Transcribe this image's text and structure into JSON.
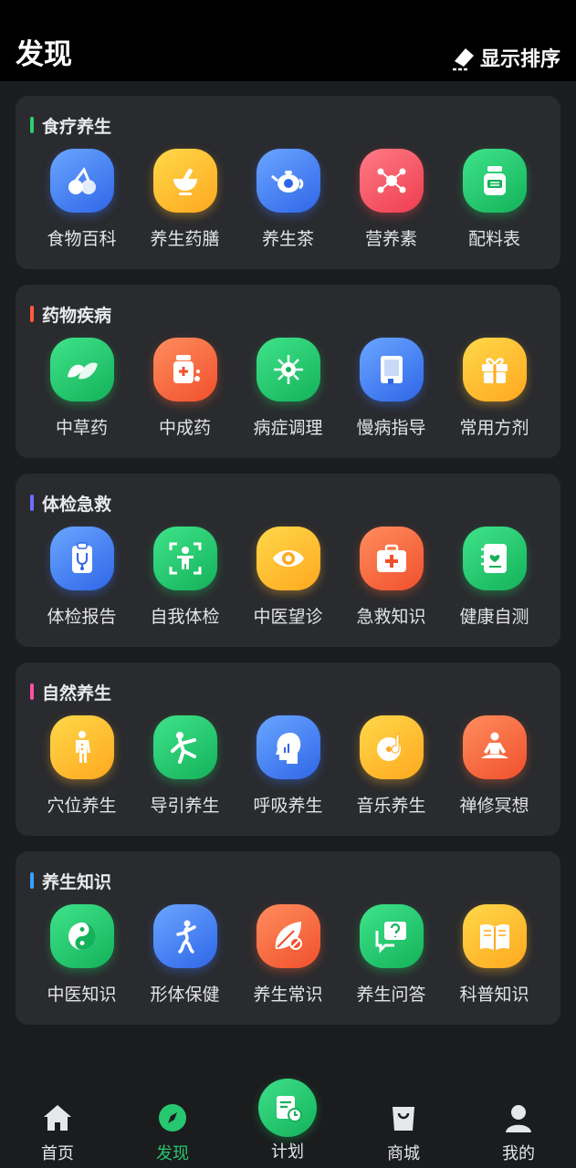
{
  "header": {
    "title": "发现",
    "sort_label": "显示排序"
  },
  "sections": [
    {
      "title": "食疗养生",
      "accent": "#2ecc71",
      "items": [
        {
          "label": "食物百科",
          "icon": "cherry-icon",
          "color": "blue"
        },
        {
          "label": "养生药膳",
          "icon": "mortar-pestle-icon",
          "color": "yellow"
        },
        {
          "label": "养生茶",
          "icon": "teapot-icon",
          "color": "blue"
        },
        {
          "label": "营养素",
          "icon": "molecule-icon",
          "color": "red"
        },
        {
          "label": "配料表",
          "icon": "jar-icon",
          "color": "green"
        }
      ]
    },
    {
      "title": "药物疾病",
      "accent": "#ff5a3c",
      "items": [
        {
          "label": "中草药",
          "icon": "leaf-icon",
          "color": "green"
        },
        {
          "label": "中成药",
          "icon": "medicine-bottle-icon",
          "color": "orange"
        },
        {
          "label": "病症调理",
          "icon": "virus-icon",
          "color": "green"
        },
        {
          "label": "慢病指导",
          "icon": "book-icon",
          "color": "blue"
        },
        {
          "label": "常用方剂",
          "icon": "gift-box-icon",
          "color": "yellow"
        }
      ]
    },
    {
      "title": "体检急救",
      "accent": "#6f6cff",
      "items": [
        {
          "label": "体检报告",
          "icon": "clipboard-stethoscope-icon",
          "color": "blue"
        },
        {
          "label": "自我体检",
          "icon": "body-scan-icon",
          "color": "green"
        },
        {
          "label": "中医望诊",
          "icon": "eye-icon",
          "color": "yellow"
        },
        {
          "label": "急救知识",
          "icon": "first-aid-kit-icon",
          "color": "orange"
        },
        {
          "label": "健康自测",
          "icon": "health-notebook-icon",
          "color": "green"
        }
      ]
    },
    {
      "title": "自然养生",
      "accent": "#ff4fa8",
      "items": [
        {
          "label": "穴位养生",
          "icon": "acupoint-body-icon",
          "color": "yellow"
        },
        {
          "label": "导引养生",
          "icon": "exercise-figure-icon",
          "color": "green"
        },
        {
          "label": "呼吸养生",
          "icon": "head-breathing-icon",
          "color": "blue"
        },
        {
          "label": "音乐养生",
          "icon": "music-disc-icon",
          "color": "yellow"
        },
        {
          "label": "禅修冥想",
          "icon": "meditation-icon",
          "color": "orange"
        }
      ]
    },
    {
      "title": "养生知识",
      "accent": "#3aa0ff",
      "items": [
        {
          "label": "中医知识",
          "icon": "yin-yang-icon",
          "color": "green"
        },
        {
          "label": "形体保健",
          "icon": "body-figure-icon",
          "color": "blue"
        },
        {
          "label": "养生常识",
          "icon": "leaf-ban-icon",
          "color": "orange"
        },
        {
          "label": "养生问答",
          "icon": "question-chat-icon",
          "color": "green"
        },
        {
          "label": "科普知识",
          "icon": "open-book-icon",
          "color": "yellow"
        }
      ]
    }
  ],
  "tabbar": {
    "home": "首页",
    "discover": "发现",
    "plan": "计划",
    "mall": "商城",
    "mine": "我的"
  }
}
